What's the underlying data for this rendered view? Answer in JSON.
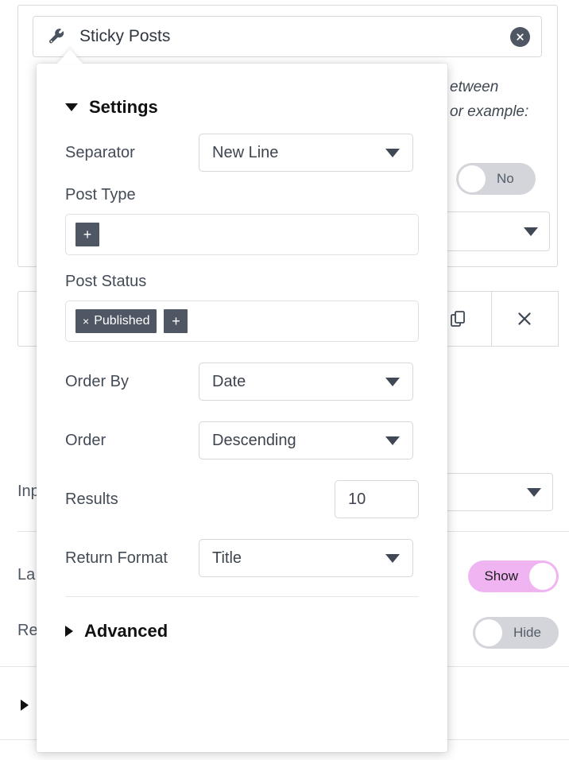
{
  "field_header": {
    "icon": "wrench-icon",
    "title": "Sticky Posts",
    "close_icon": "close-circle-icon"
  },
  "background": {
    "description_lines": [
      "etween",
      "or example:"
    ],
    "labels": {
      "input": "Inp",
      "label": "La",
      "required": "Re"
    },
    "toggles": [
      {
        "name": "no-toggle",
        "label": "No",
        "state": "off"
      },
      {
        "name": "show-toggle",
        "label": "Show",
        "state": "on",
        "color": "#f0b4f2"
      },
      {
        "name": "hide-toggle",
        "label": "Hide",
        "state": "off"
      }
    ],
    "action_buttons": [
      {
        "name": "duplicate-button",
        "icon": "copy-icon"
      },
      {
        "name": "delete-button",
        "icon": "close-x-icon"
      }
    ]
  },
  "popover": {
    "settings": {
      "title": "Settings",
      "expanded": true,
      "fields": {
        "separator": {
          "label": "Separator",
          "value": "New Line",
          "type": "select"
        },
        "post_type": {
          "label": "Post Type",
          "type": "tokens",
          "tokens": [],
          "add_label": "+"
        },
        "post_status": {
          "label": "Post Status",
          "type": "tokens",
          "tokens": [
            {
              "label": "Published",
              "remove": "×"
            }
          ],
          "add_label": "+"
        },
        "order_by": {
          "label": "Order By",
          "value": "Date",
          "type": "select"
        },
        "order": {
          "label": "Order",
          "value": "Descending",
          "type": "select"
        },
        "results": {
          "label": "Results",
          "value": "10",
          "type": "number"
        },
        "return_format": {
          "label": "Return Format",
          "value": "Title",
          "type": "select"
        }
      }
    },
    "advanced": {
      "title": "Advanced",
      "expanded": false
    }
  }
}
